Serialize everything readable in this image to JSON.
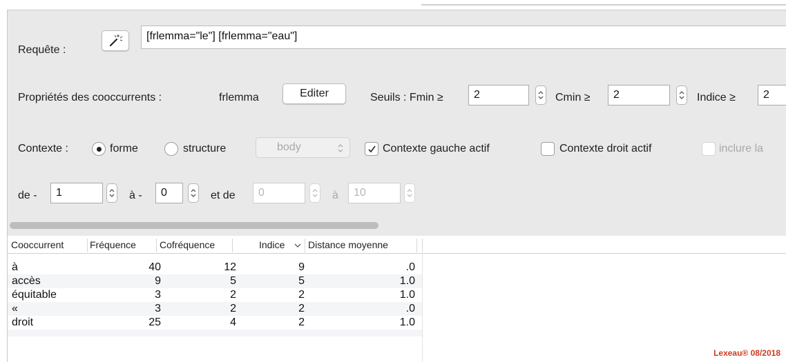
{
  "query": {
    "label": "Requête :",
    "wand_icon": "magic-wand-icon",
    "value": "[frlemma=\"le\"] [frlemma=\"eau\"]"
  },
  "properties": {
    "label": "Propriétés des cooccurrents :",
    "value": "frlemma",
    "edit_button": "Editer",
    "thresholds_label": "Seuils : Fmin ≥",
    "fmin": "2",
    "cmin_label": "Cmin ≥",
    "cmin": "2",
    "indice_label": "Indice ≥",
    "indice": "2"
  },
  "context": {
    "label": "Contexte :",
    "radio_forme": "forme",
    "radio_structure": "structure",
    "selected": "forme",
    "structure_select": "body",
    "left_check": "Contexte gauche actif",
    "left_checked": true,
    "right_check": "Contexte droit actif",
    "right_checked": false,
    "include_check": "inclure la"
  },
  "range": {
    "de_label": "de -",
    "de_value": "1",
    "a_label": "à -",
    "a_value": "0",
    "et_de_label": "et de",
    "et_de_value": "0",
    "a2_label": "à",
    "a2_value": "10"
  },
  "table": {
    "columns": [
      "Cooccurrent",
      "Fréquence",
      "Cofréquence",
      "Indice",
      "Distance moyenne"
    ],
    "sort_column": "Indice",
    "sort_direction": "descending",
    "rows": [
      [
        "à",
        "40",
        "12",
        "9",
        ".0"
      ],
      [
        "accès",
        "9",
        "5",
        "5",
        "1.0"
      ],
      [
        "équitable",
        "3",
        "2",
        "2",
        "1.0"
      ],
      [
        "«",
        "3",
        "2",
        "2",
        ".0"
      ],
      [
        "droit",
        "25",
        "4",
        "2",
        "1.0"
      ]
    ]
  },
  "watermark": "Lexeau® 08/2018",
  "colors": {
    "panel": "#e9e9e9",
    "watermark": "#d23a1c",
    "alt_row": "#f3f5f7"
  }
}
